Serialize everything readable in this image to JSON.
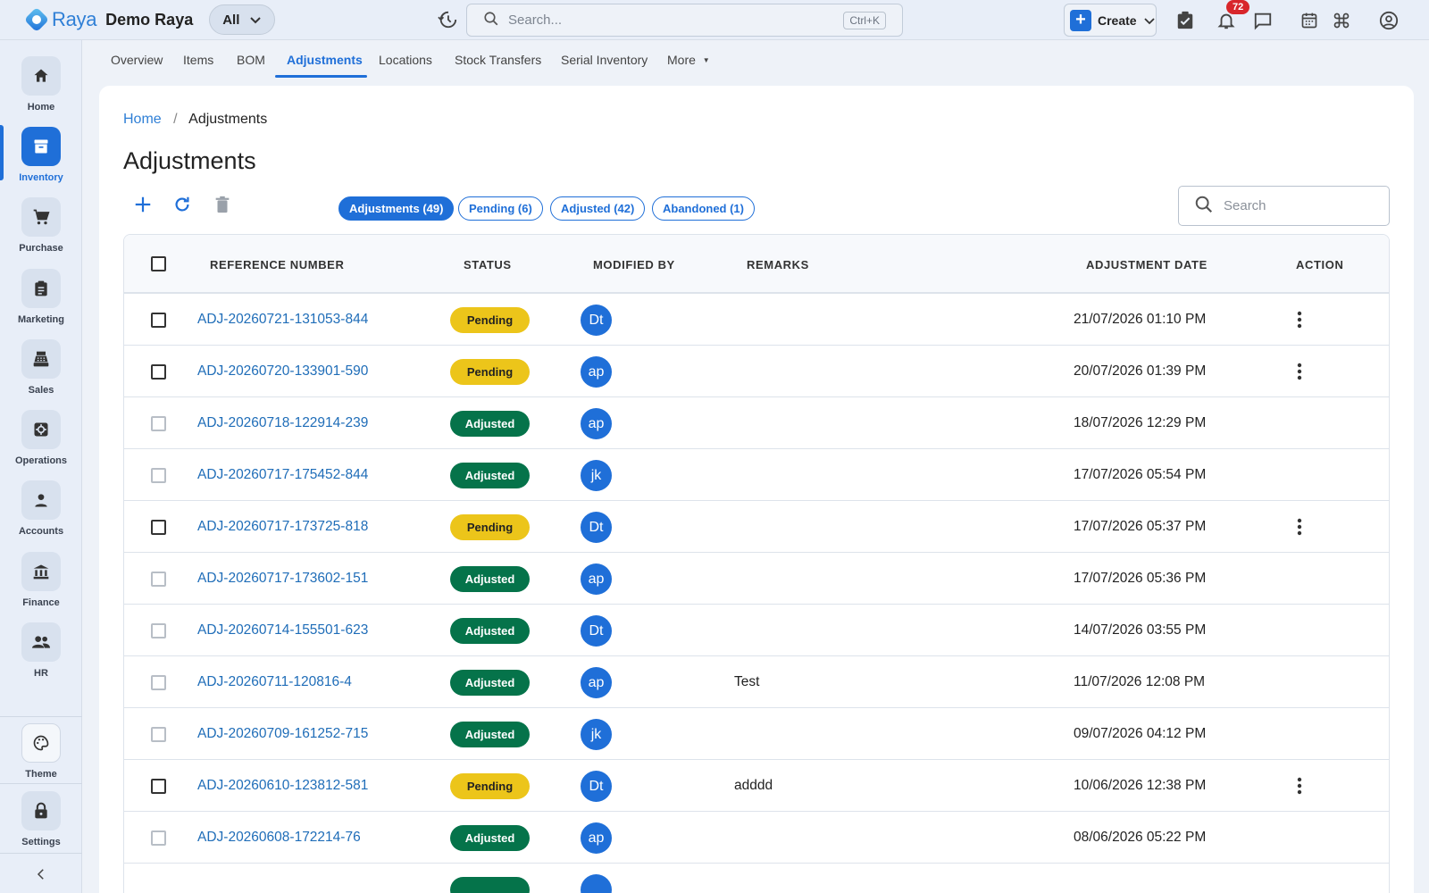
{
  "app": {
    "logo_text": "Raya",
    "org_name": "Demo Raya",
    "scope_select": "All",
    "search_placeholder": "Search...",
    "search_shortcut": "Ctrl+K",
    "create_label": "Create",
    "notification_count": "72"
  },
  "sidebar": {
    "items": [
      {
        "label": "Home",
        "icon": "home-icon"
      },
      {
        "label": "Inventory",
        "icon": "archive-icon"
      },
      {
        "label": "Purchase",
        "icon": "cart-icon"
      },
      {
        "label": "Marketing",
        "icon": "clipboard-icon"
      },
      {
        "label": "Sales",
        "icon": "cash-register-icon"
      },
      {
        "label": "Operations",
        "icon": "settings-cog-icon"
      },
      {
        "label": "Accounts",
        "icon": "person-icon"
      },
      {
        "label": "Finance",
        "icon": "bank-icon"
      },
      {
        "label": "HR",
        "icon": "people-icon"
      }
    ],
    "theme_label": "Theme",
    "settings_label": "Settings"
  },
  "subnav": {
    "tabs": [
      "Overview",
      "Items",
      "BOM",
      "Adjustments",
      "Locations",
      "Stock Transfers",
      "Serial Inventory",
      "More"
    ],
    "active": "Adjustments"
  },
  "breadcrumb": {
    "home": "Home",
    "current": "Adjustments"
  },
  "page": {
    "title": "Adjustments"
  },
  "filters": [
    {
      "label": "Adjustments (49)",
      "active": true
    },
    {
      "label": "Pending (6)",
      "active": false
    },
    {
      "label": "Adjusted (42)",
      "active": false
    },
    {
      "label": "Abandoned (1)",
      "active": false
    }
  ],
  "table_search_placeholder": "Search",
  "table": {
    "columns": [
      "REFERENCE NUMBER",
      "STATUS",
      "MODIFIED BY",
      "REMARKS",
      "ADJUSTMENT DATE",
      "ACTION"
    ],
    "rows": [
      {
        "ref": "ADJ-20260721-131053-844",
        "status": "Pending",
        "by": "Dt",
        "remarks": "",
        "date": "21/07/2026 01:10 PM"
      },
      {
        "ref": "ADJ-20260720-133901-590",
        "status": "Pending",
        "by": "ap",
        "remarks": "",
        "date": "20/07/2026 01:39 PM"
      },
      {
        "ref": "ADJ-20260718-122914-239",
        "status": "Adjusted",
        "by": "ap",
        "remarks": "",
        "date": "18/07/2026 12:29 PM"
      },
      {
        "ref": "ADJ-20260717-175452-844",
        "status": "Adjusted",
        "by": "jk",
        "remarks": "",
        "date": "17/07/2026 05:54 PM"
      },
      {
        "ref": "ADJ-20260717-173725-818",
        "status": "Pending",
        "by": "Dt",
        "remarks": "",
        "date": "17/07/2026 05:37 PM"
      },
      {
        "ref": "ADJ-20260717-173602-151",
        "status": "Adjusted",
        "by": "ap",
        "remarks": "",
        "date": "17/07/2026 05:36 PM"
      },
      {
        "ref": "ADJ-20260714-155501-623",
        "status": "Adjusted",
        "by": "Dt",
        "remarks": "",
        "date": "14/07/2026 03:55 PM"
      },
      {
        "ref": "ADJ-20260711-120816-4",
        "status": "Adjusted",
        "by": "ap",
        "remarks": "Test",
        "date": "11/07/2026 12:08 PM"
      },
      {
        "ref": "ADJ-20260709-161252-715",
        "status": "Adjusted",
        "by": "jk",
        "remarks": "",
        "date": "09/07/2026 04:12 PM"
      },
      {
        "ref": "ADJ-20260610-123812-581",
        "status": "Pending",
        "by": "Dt",
        "remarks": "adddd",
        "date": "10/06/2026 12:38 PM"
      },
      {
        "ref": "ADJ-20260608-172214-76",
        "status": "Adjusted",
        "by": "ap",
        "remarks": "",
        "date": "08/06/2026 05:22 PM"
      }
    ]
  },
  "colors": {
    "primary": "#1f6fd8",
    "pending": "#ecc51a",
    "adjusted": "#05734a",
    "notification": "#d8262b"
  }
}
